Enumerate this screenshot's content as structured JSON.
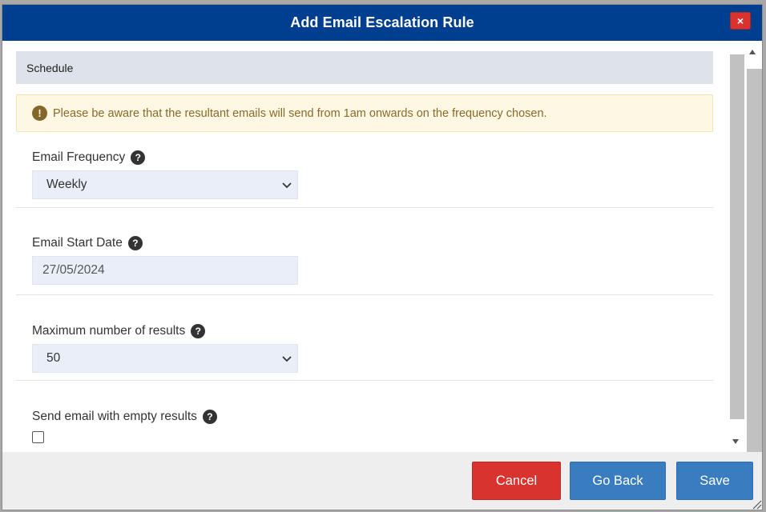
{
  "dialog": {
    "title": "Add Email Escalation Rule",
    "close_label": "×"
  },
  "section": {
    "title": "Schedule"
  },
  "alert": {
    "icon": "!",
    "text": "Please be aware that the resultant emails will send from 1am onwards on the frequency chosen."
  },
  "fields": {
    "frequency": {
      "label": "Email Frequency",
      "value": "Weekly"
    },
    "start_date": {
      "label": "Email Start Date",
      "value": "27/05/2024"
    },
    "max_results": {
      "label": "Maximum number of results",
      "value": "50"
    },
    "empty_results": {
      "label": "Send email with empty results",
      "checked": false
    }
  },
  "help_glyph": "?",
  "buttons": {
    "cancel": "Cancel",
    "go_back": "Go Back",
    "save": "Save"
  },
  "colors": {
    "header": "#003f8f",
    "danger": "#d9332f",
    "primary": "#3a7cc0",
    "alert_bg": "#fdf7e3",
    "alert_text": "#8a6a2a"
  }
}
